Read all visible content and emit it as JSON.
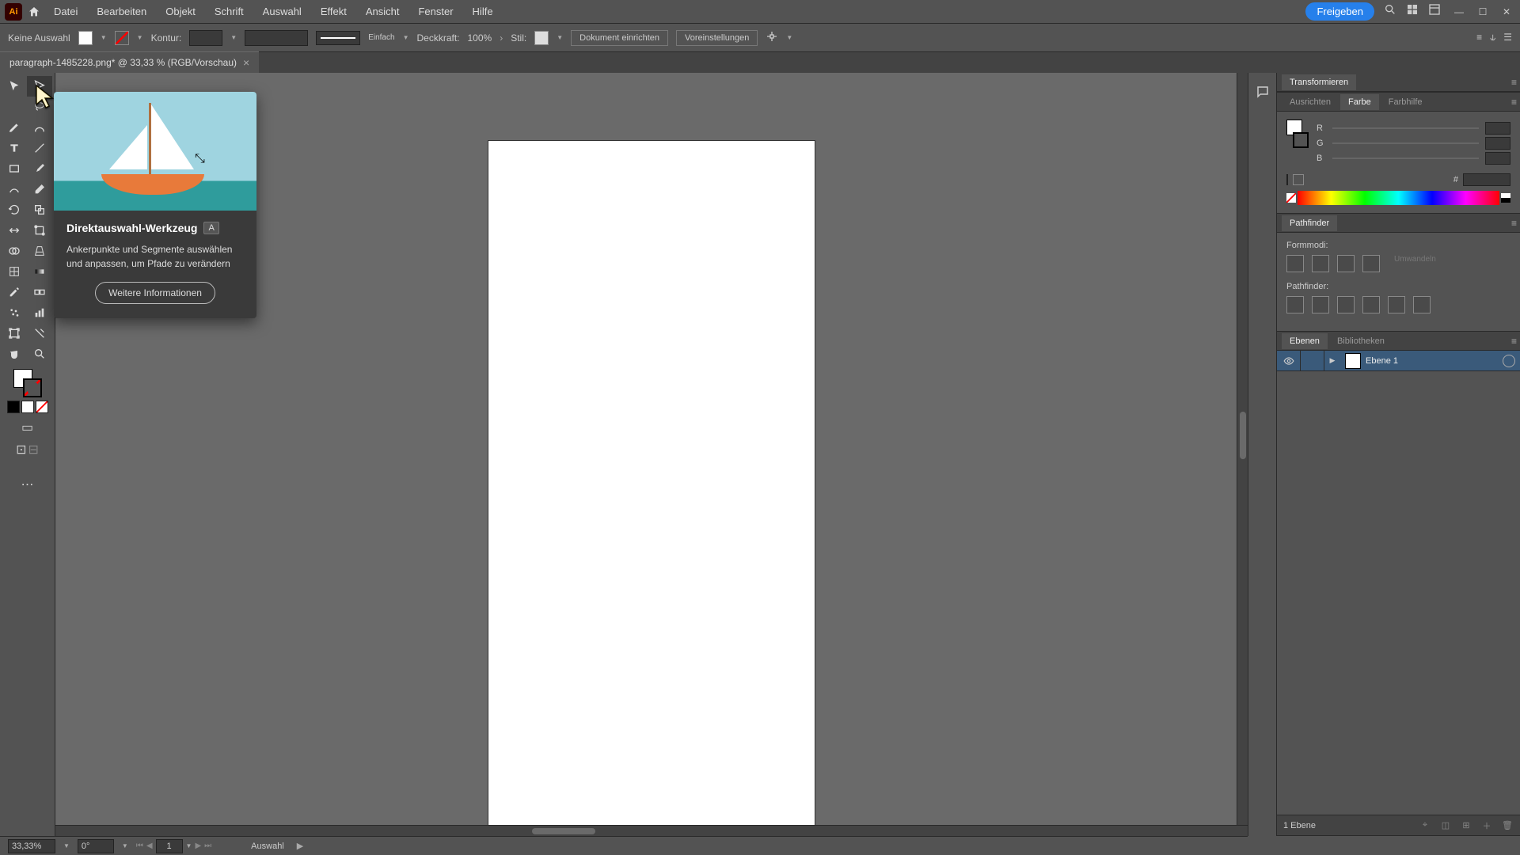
{
  "app": {
    "logo": "Ai"
  },
  "menubar": {
    "items": [
      "Datei",
      "Bearbeiten",
      "Objekt",
      "Schrift",
      "Auswahl",
      "Effekt",
      "Ansicht",
      "Fenster",
      "Hilfe"
    ],
    "share": "Freigeben"
  },
  "controlbar": {
    "selection_label": "Keine Auswahl",
    "stroke_label": "Kontur:",
    "stroke_style_label": "Einfach",
    "opacity_label": "Deckkraft:",
    "opacity_value": "100%",
    "style_label": "Stil:",
    "doc_setup": "Dokument einrichten",
    "prefs": "Voreinstellungen"
  },
  "doctab": {
    "title": "paragraph-1485228.png* @ 33,33 % (RGB/Vorschau)"
  },
  "tooltip": {
    "title": "Direktauswahl-Werkzeug",
    "shortcut": "A",
    "desc": "Ankerpunkte und Segmente auswählen und anpassen, um Pfade zu verändern",
    "more": "Weitere Informationen"
  },
  "panels": {
    "transform_tab": "Transformieren",
    "align_tab": "Ausrichten",
    "color_tab": "Farbe",
    "colorguide_tab": "Farbhilfe",
    "rgb": {
      "r": "R",
      "g": "G",
      "b": "B",
      "hex_label": "#"
    },
    "pathfinder_tab": "Pathfinder",
    "shapemodes_label": "Formmodi:",
    "pathfinder_label": "Pathfinder:",
    "expand_label": "Umwandeln",
    "layers_tab": "Ebenen",
    "libraries_tab": "Bibliotheken",
    "layer1": "Ebene 1",
    "layer_count": "1 Ebene"
  },
  "statusbar": {
    "zoom": "33,33%",
    "rotation": "0°",
    "artboard_num": "1",
    "tool_name": "Auswahl"
  }
}
